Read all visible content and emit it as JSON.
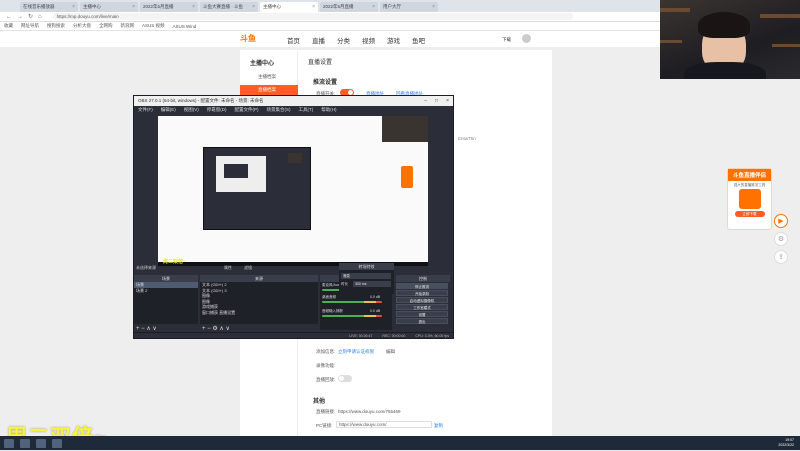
{
  "browser": {
    "tabs": [
      {
        "label": "在线音乐播放器"
      },
      {
        "label": "主播中心"
      },
      {
        "label": "2022年5月直播"
      },
      {
        "label": "斗鱼大赛直播 · 斗鱼"
      },
      {
        "label": "主播中心",
        "active": true
      },
      {
        "label": "2022年5月直播"
      },
      {
        "label": "用户大厅"
      }
    ],
    "url": "https://mp.douyu.com/live/main",
    "bookmarks": [
      "收藏",
      "网址导航",
      "搜狗搜索",
      "分析大盘",
      "全网购",
      "新浪网",
      "ASUS 视频",
      "ASUS Wind"
    ]
  },
  "site": {
    "logo": "斗鱼",
    "nav": [
      {
        "label": "首页"
      },
      {
        "label": "直播"
      },
      {
        "label": "分类"
      },
      {
        "label": "视频"
      },
      {
        "label": "游戏"
      },
      {
        "label": "鱼吧"
      }
    ],
    "account": "下载"
  },
  "sidebar": {
    "title": "主播中心",
    "items": [
      {
        "label": "主播档案"
      },
      {
        "label": "直播档案",
        "active": true
      }
    ]
  },
  "content": {
    "title": "直播设置",
    "push_section": "推流设置",
    "push_label": "直播开关:",
    "link1": "直播地址",
    "link2": "回看直播地址",
    "extra_label": "添加信息:",
    "extra_link": "立刻申请认证权限",
    "extra_suffix": "编辑",
    "record_label": "录像功能:",
    "stream_label": "直播回放:",
    "links_title": "其他",
    "live_url_label": "直播链接:",
    "live_url": "https://www.douyu.com/755469",
    "pc_url_label": "PC链接:",
    "pc_url": "https://www.douyu.com/",
    "copy": "复制",
    "stream_key_hint": "EntwT5n"
  },
  "ad": {
    "head": "斗鱼直播伴侣",
    "sub": "强大的直播推流工具",
    "button": "立即下载"
  },
  "obs": {
    "title": "OBS 27.0.1 (64-bit, windows) - 配置文件: 未命名 - 场景: 未命名",
    "menu": [
      "文件(F)",
      "编辑(E)",
      "视图(V)",
      "停靠窗(D)",
      "配置文件(P)",
      "场景集合(S)",
      "工具(T)",
      "帮助(H)"
    ],
    "preview_subtitle": "周二双倍~",
    "scenes_header": "场景",
    "scenes": [
      "场景",
      "场景 2"
    ],
    "sources_header": "来源",
    "sources": [
      "文本 (GDI+) 2",
      "文本 (GDI+) 3",
      "图像",
      "图像",
      "游戏捕获",
      "窗口捕获 直播设置"
    ],
    "no_source": "未选择来源",
    "props_btn": "属性",
    "filter_btn": "滤镜",
    "mixer_header": "混音器",
    "mixer": [
      {
        "label": "麦克风/Aux",
        "db": "0.0 dB"
      },
      {
        "label": "桌面音频",
        "db": "0.0 dB"
      },
      {
        "label": "音频输入捕获",
        "db": "0.0 dB"
      }
    ],
    "transitions_header": "转场特效",
    "transition_value": "渐变",
    "duration_label": "时长",
    "duration_value": "300 ms",
    "controls_header": "控制",
    "controls": [
      "停止推流",
      "开始录制",
      "启动虚拟摄像机",
      "工作室模式",
      "设置",
      "退出"
    ],
    "status": [
      "LIVE: 00:26:47",
      "REC: 00:00:00",
      "CPU: 3.3%, 60.00 fps"
    ]
  },
  "overlay": {
    "text": "周二双倍~"
  },
  "taskbar": {
    "time": "19:07",
    "date": "2022/3/22"
  }
}
